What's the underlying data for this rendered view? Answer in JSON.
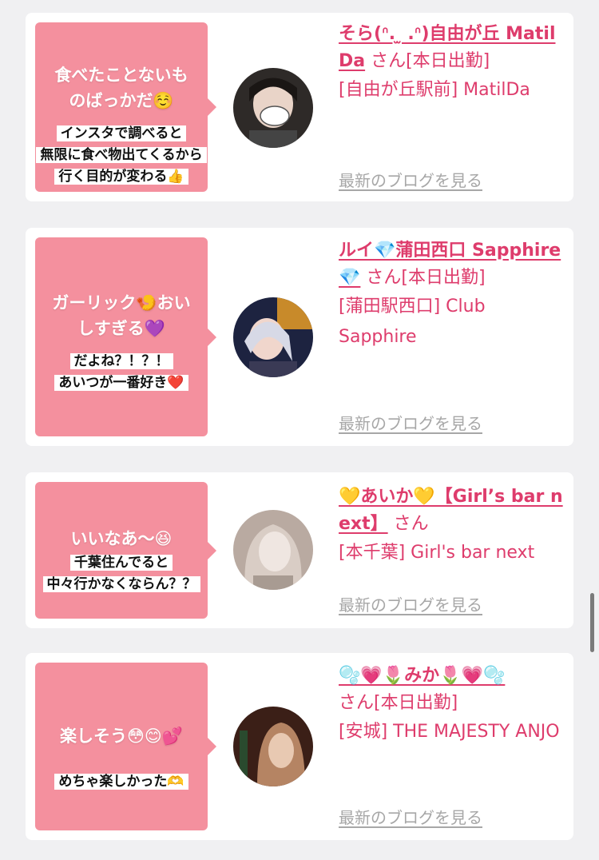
{
  "posts": [
    {
      "bubble": [
        "食べたことないも",
        "のばっかだ☺️"
      ],
      "reply": [
        "インスタで調べると",
        "無限に食べ物出てくるから",
        "行く目的が変わる👍"
      ],
      "name": "そら(ᐢ. ̫ .ᐢ)自由が丘 MatilDa",
      "san": " さん[本日出勤]",
      "shop": "[自由が丘駅前] MatilDa",
      "blog_link": "最新のブログを見る",
      "avatar_colors": [
        "#2e2a28",
        "#e9d4c8"
      ]
    },
    {
      "bubble": [
        "ガーリック🍤おい",
        "しすぎる💜"
      ],
      "reply": [
        "だよね？！？！",
        "あいつが一番好き❤️"
      ],
      "name": "ルイ💎蒲田西口 Sapphire💎",
      "san": " さん[本日出勤]",
      "shop": "[蒲田駅西口] Club Sapphire",
      "blog_link": "最新のブログを見る",
      "avatar_colors": [
        "#1d2340",
        "#d7d9e6"
      ]
    },
    {
      "bubble": [
        "いいなあ〜😆"
      ],
      "reply": [
        "千葉住んでると",
        "中々行かなくならん？？"
      ],
      "name": "💛あいか💛【Girl’s bar next】",
      "san": " さん",
      "shop": "[本千葉] Girl's bar next",
      "blog_link": "最新のブログを見る",
      "avatar_colors": [
        "#b9aaa1",
        "#efe6e1"
      ]
    },
    {
      "bubble": [
        "楽しそう😳😊💕"
      ],
      "reply": [
        "めちゃ楽しかった🫶"
      ],
      "name": "🫧💗🌷みか🌷💗🫧",
      "san": "さん[本日出勤]",
      "shop": "[安城] THE MAJESTY ANJO",
      "blog_link": "最新のブログを見る",
      "avatar_colors": [
        "#3b1f17",
        "#b58463"
      ]
    }
  ]
}
